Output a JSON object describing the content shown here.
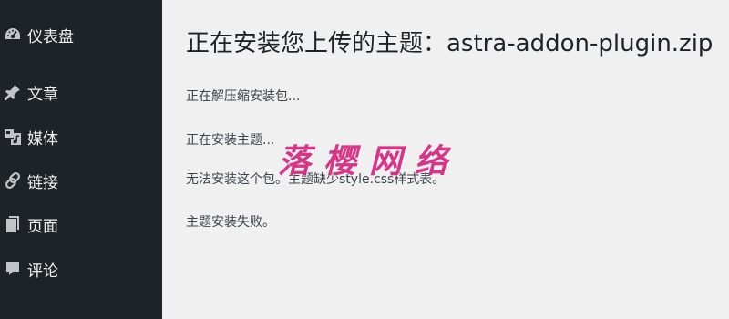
{
  "sidebar": {
    "items": [
      {
        "label": "仪表盘",
        "icon": "dashboard-icon"
      },
      {
        "label": "文章",
        "icon": "pushpin-icon"
      },
      {
        "label": "媒体",
        "icon": "media-icon"
      },
      {
        "label": "链接",
        "icon": "link-icon"
      },
      {
        "label": "页面",
        "icon": "page-icon"
      },
      {
        "label": "评论",
        "icon": "comment-icon"
      }
    ]
  },
  "main": {
    "title": "正在安装您上传的主题：astra-addon-plugin.zip",
    "messages": [
      "正在解压缩安装包...",
      "正在安装主题...",
      "无法安装这个包。主题缺少style.css样式表。",
      "主题安装失败。"
    ]
  },
  "watermark": {
    "text": "落樱网络",
    "color": "#d6267f"
  },
  "colors": {
    "sidebar_bg": "#1d2327",
    "content_bg": "#f0f0f1",
    "menu_text": "#f0f0f1"
  }
}
